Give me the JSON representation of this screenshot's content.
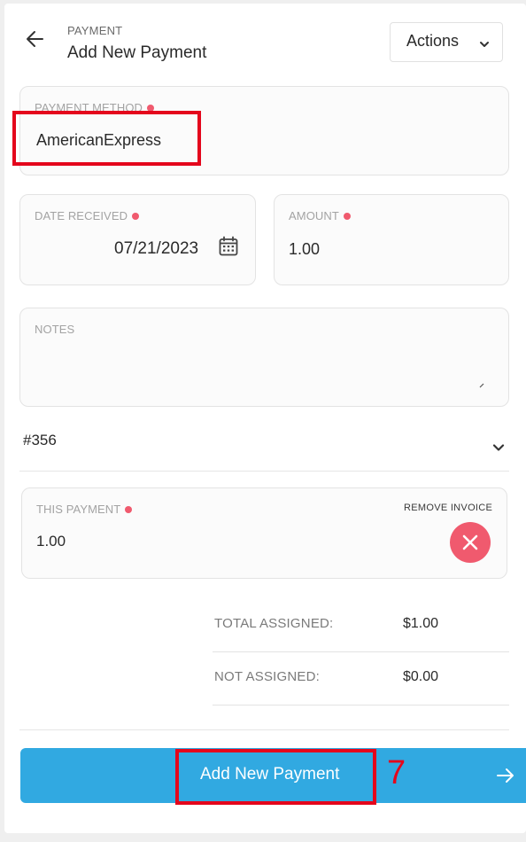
{
  "header": {
    "eyebrow": "PAYMENT",
    "title": "Add New Payment",
    "actions_label": "Actions"
  },
  "payment_method": {
    "label": "PAYMENT METHOD",
    "value": "AmericanExpress"
  },
  "date_received": {
    "label": "DATE RECEIVED",
    "value": "07/21/2023"
  },
  "amount": {
    "label": "AMOUNT",
    "value": "1.00"
  },
  "notes": {
    "label": "NOTES",
    "value": ""
  },
  "invoice": {
    "number": "#356",
    "this_payment_label": "THIS PAYMENT",
    "this_payment_value": "1.00",
    "remove_label": "REMOVE INVOICE"
  },
  "totals": {
    "assigned_label": "TOTAL ASSIGNED:",
    "assigned_value": "$1.00",
    "not_assigned_label": "NOT ASSIGNED:",
    "not_assigned_value": "$0.00"
  },
  "submit": {
    "label": "Add New Payment"
  },
  "annotation": {
    "step": "7"
  },
  "colors": {
    "accent": "#31a9e1",
    "required": "#f05a6e",
    "highlight": "#e4061c"
  },
  "icons": {
    "back": "arrow-left-icon",
    "actions_chevron": "chevron-down-icon",
    "calendar": "calendar-icon",
    "invoice_chevron": "chevron-down-icon",
    "remove": "close-icon",
    "submit_arrow": "arrow-right-icon"
  }
}
